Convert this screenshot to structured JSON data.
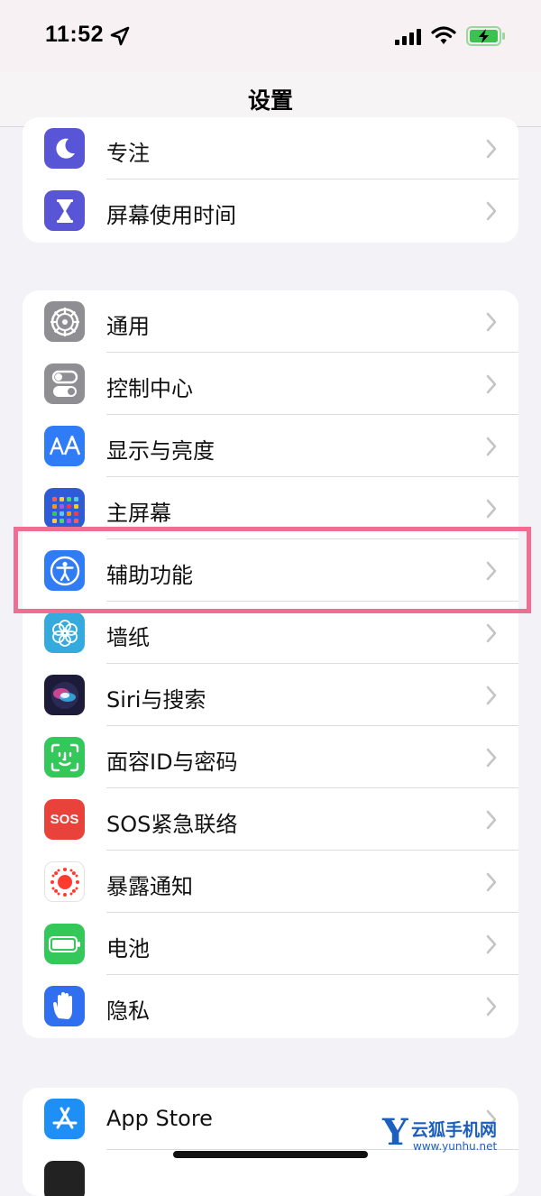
{
  "status_bar": {
    "time": "11:52"
  },
  "nav": {
    "title": "设置"
  },
  "groups": [
    {
      "items": [
        {
          "label": "专注",
          "icon": "moon-icon",
          "color": "#5856d6"
        },
        {
          "label": "屏幕使用时间",
          "icon": "hourglass-icon",
          "color": "#5856d6"
        }
      ]
    },
    {
      "items": [
        {
          "label": "通用",
          "icon": "gear-icon",
          "color": "#8e8e93"
        },
        {
          "label": "控制中心",
          "icon": "toggles-icon",
          "color": "#8e8e93"
        },
        {
          "label": "显示与亮度",
          "icon": "display-aa-icon",
          "color": "#2f7cf6"
        },
        {
          "label": "主屏幕",
          "icon": "home-screen-icon",
          "color": "#2f5cd6"
        },
        {
          "label": "辅助功能",
          "icon": "accessibility-icon",
          "color": "#2f7cf6"
        },
        {
          "label": "墙纸",
          "icon": "wallpaper-flower-icon",
          "color": "#35aadc"
        },
        {
          "label": "Siri与搜索",
          "icon": "siri-icon",
          "color": "#1c1c3a"
        },
        {
          "label": "面容ID与密码",
          "icon": "faceid-icon",
          "color": "#34c759"
        },
        {
          "label": "SOS紧急联络",
          "icon": "sos-icon",
          "color": "#e8423a",
          "icon_text": "SOS"
        },
        {
          "label": "暴露通知",
          "icon": "exposure-icon",
          "color": "#ffffff"
        },
        {
          "label": "电池",
          "icon": "battery-icon",
          "color": "#34c759"
        },
        {
          "label": "隐私",
          "icon": "hand-icon",
          "color": "#2f6ff0"
        }
      ]
    },
    {
      "items": [
        {
          "label": "App Store",
          "icon": "app-store-icon",
          "color": "#1e8ff5"
        }
      ]
    }
  ],
  "highlight_color": "#ee6f93",
  "watermark": {
    "letter": "Y",
    "name": "云狐手机网",
    "url": "www.yunhu.net"
  }
}
